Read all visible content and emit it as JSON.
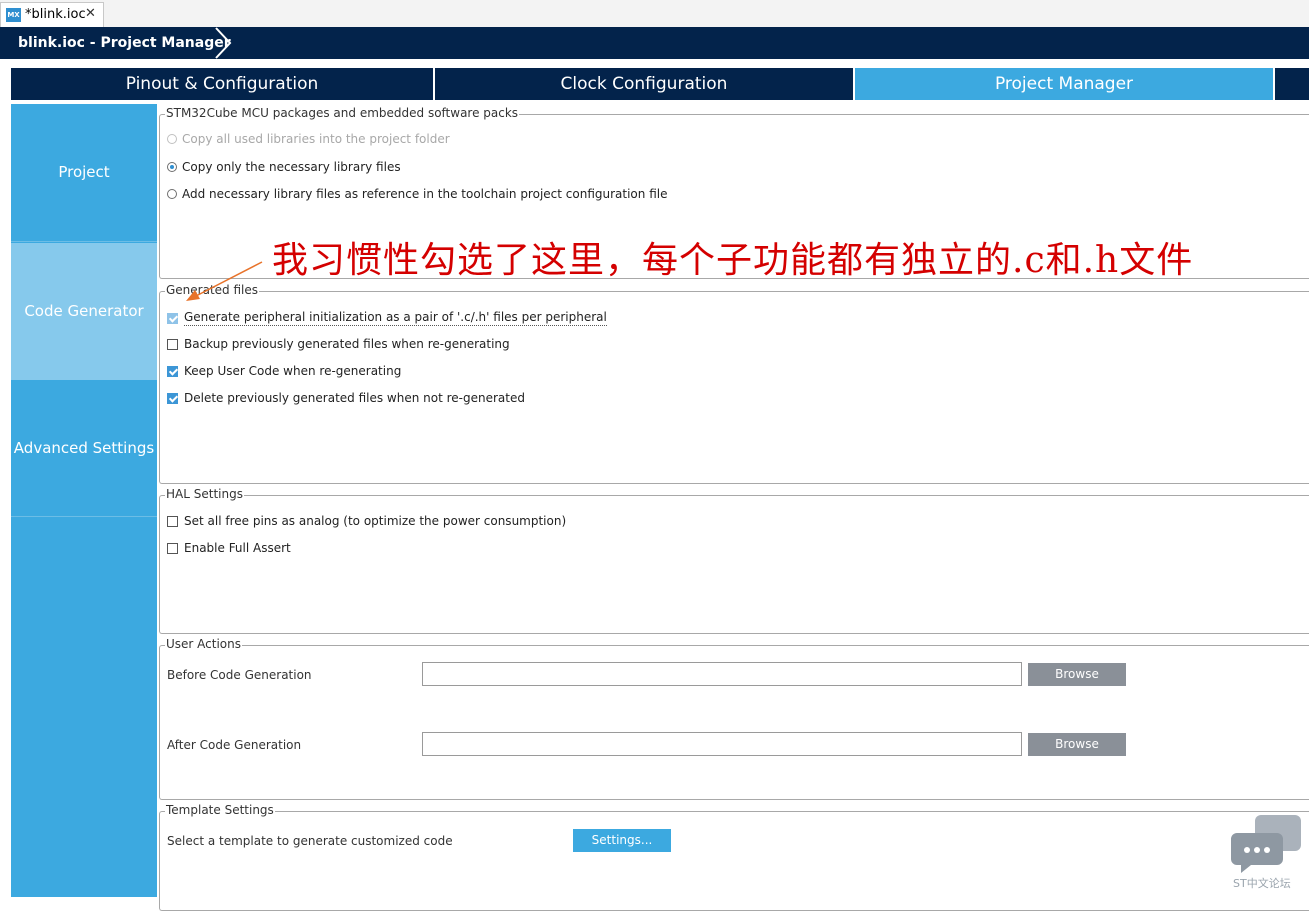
{
  "editor_tab": {
    "icon": "MX",
    "label": "*blink.ioc",
    "close": "✕"
  },
  "breadcrumb": {
    "label": "blink.ioc - Project Manager"
  },
  "main_tabs": [
    {
      "label": "Pinout & Configuration",
      "active": false
    },
    {
      "label": "Clock Configuration",
      "active": false
    },
    {
      "label": "Project Manager",
      "active": true
    }
  ],
  "sidebar": {
    "items": [
      {
        "label": "Project",
        "active": false
      },
      {
        "label": "Code Generator",
        "active": true
      },
      {
        "label": "Advanced Settings",
        "active": false
      }
    ]
  },
  "packages": {
    "legend": "STM32Cube MCU packages and embedded software packs",
    "options": [
      {
        "label": "Copy all used libraries into the project folder",
        "selected": false,
        "enabled": false
      },
      {
        "label": "Copy only the necessary library files",
        "selected": true,
        "enabled": true
      },
      {
        "label": "Add necessary library files as reference in the toolchain project configuration file",
        "selected": false,
        "enabled": true
      }
    ]
  },
  "generated_files": {
    "legend": "Generated files",
    "options": [
      {
        "label": "Generate peripheral initialization as a pair of '.c/.h' files per peripheral",
        "checked": true
      },
      {
        "label": "Backup previously generated files when re-generating",
        "checked": false
      },
      {
        "label": "Keep User Code when re-generating",
        "checked": true
      },
      {
        "label": "Delete previously generated files when not re-generated",
        "checked": true
      }
    ]
  },
  "hal_settings": {
    "legend": "HAL Settings",
    "options": [
      {
        "label": "Set all free pins as analog (to optimize the power consumption)",
        "checked": false
      },
      {
        "label": "Enable Full Assert",
        "checked": false
      }
    ]
  },
  "user_actions": {
    "legend": "User Actions",
    "before_label": "Before Code Generation",
    "before_value": "",
    "after_label": "After Code Generation",
    "after_value": "",
    "browse_label": "Browse"
  },
  "template_settings": {
    "legend": "Template Settings",
    "label": "Select a template to generate customized code",
    "button": "Settings..."
  },
  "annotation": {
    "text": "我习惯性勾选了这里，每个子功能都有独立的.c和.h文件",
    "color": "#d40000"
  },
  "watermark": {
    "text": "ST中文论坛"
  },
  "colors": {
    "navy": "#03234b",
    "accent": "#3ca9e0",
    "sidebar_active": "#86c9ec",
    "browse": "#8a9098"
  }
}
